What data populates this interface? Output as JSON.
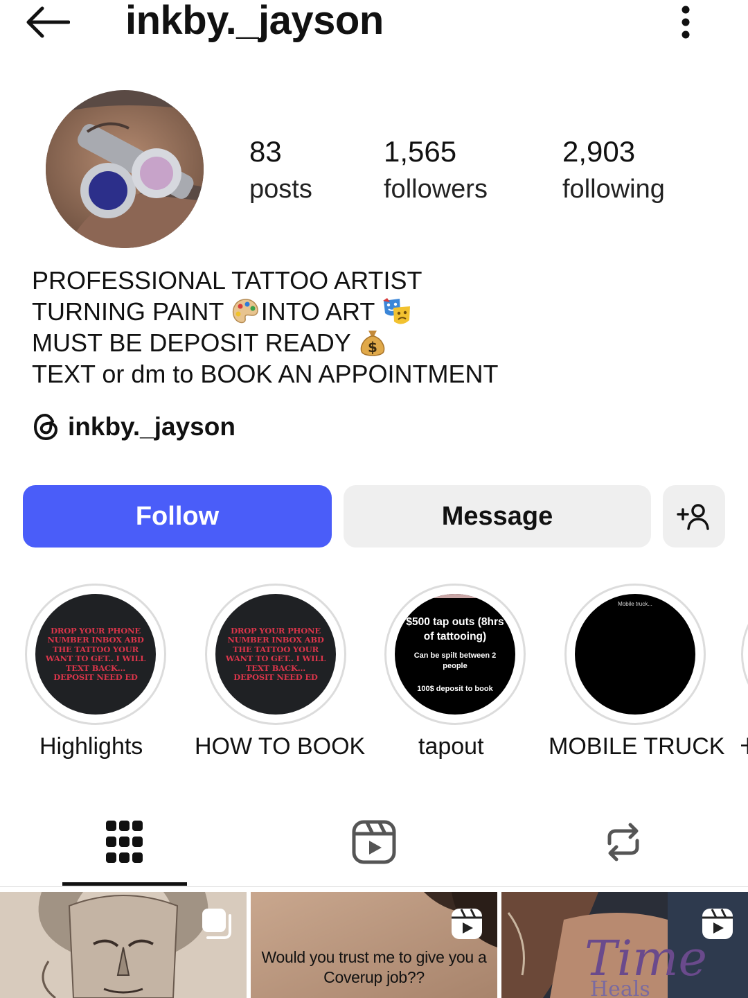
{
  "header": {
    "username": "inkby._jayson",
    "back_icon": "arrow-left-icon",
    "more_icon": "more-vertical-icon"
  },
  "profile": {
    "stats": [
      {
        "value": "83",
        "label": "posts"
      },
      {
        "value": "1,565",
        "label": "followers"
      },
      {
        "value": "2,903",
        "label": "following"
      }
    ],
    "bio": {
      "line1": "PROFESSIONAL TATTOO ARTIST",
      "line2a": "TURNING PAINT ",
      "line2b": "INTO ART ",
      "line3": "MUST BE DEPOSIT READY ",
      "line4": "TEXT or dm to BOOK AN APPOINTMENT"
    },
    "threads_handle": "inkby._jayson"
  },
  "actions": {
    "follow_label": "Follow",
    "message_label": "Message",
    "add_user_icon": "add-user-icon"
  },
  "highlights": [
    {
      "label": "Highlights",
      "cover_text": "DROP YOUR PHONE NUMBER INBOX ABD THE TATTOO YOUR WANT TO GET.. I WILL TEXT BACK... DEPOSIT NEED ED"
    },
    {
      "label": "HOW TO BOOK",
      "cover_text": "DROP YOUR PHONE NUMBER INBOX ABD THE TATTOO YOUR WANT TO GET.. I WILL TEXT BACK... DEPOSIT NEED ED"
    },
    {
      "label": "tapout",
      "cover_title": "$500 tap outs (8hrs of tattooing)",
      "cover_sub": "Can be spilt between 2 people",
      "cover_foot": "100$ deposit to book"
    },
    {
      "label": "MOBILE TRUCK",
      "cover_text": "Mobile truck..."
    },
    {
      "label": "H"
    }
  ],
  "tabs": [
    {
      "name": "grid",
      "icon": "grid-icon",
      "active": true
    },
    {
      "name": "reels",
      "icon": "reels-icon",
      "active": false
    },
    {
      "name": "reposts",
      "icon": "repost-icon",
      "active": false
    }
  ],
  "posts": [
    {
      "kind": "carousel",
      "badge_icon": "carousel-icon"
    },
    {
      "kind": "reel",
      "badge_icon": "reel-icon",
      "caption_line1": "Would you trust me to give you a",
      "caption_line2": "Coverup job??"
    },
    {
      "kind": "reel",
      "badge_icon": "reel-icon",
      "tattoo_text": "Time",
      "tattoo_text2": "Heals"
    }
  ],
  "colors": {
    "accent": "#4a5df9",
    "button_gray": "#efefef",
    "highlight_red_text": "#d9354a"
  }
}
